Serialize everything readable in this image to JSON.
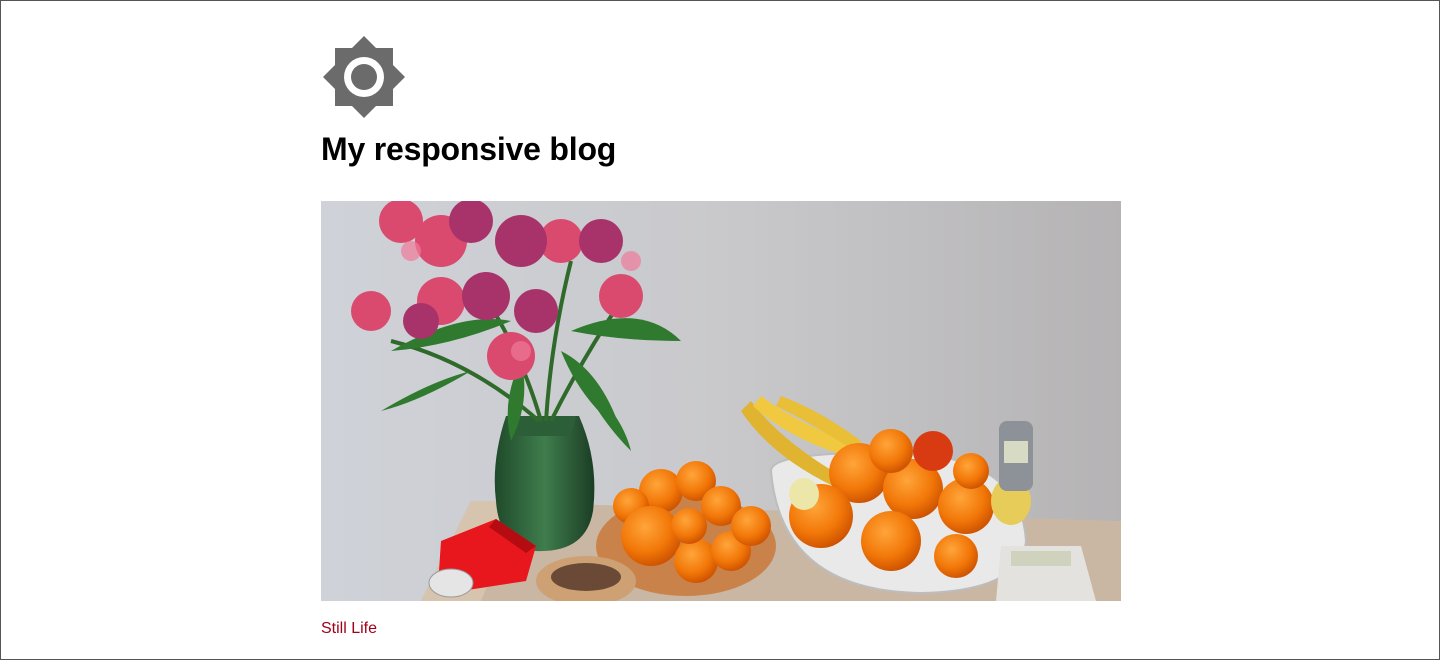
{
  "site": {
    "logo_icon": "sun-brightness-icon",
    "title": "My responsive blog"
  },
  "post": {
    "image_subject": "still-life-photo",
    "caption_link": "Still Life"
  },
  "colors": {
    "logo": "#6b6b6b",
    "link": "#a00018",
    "title": "#000000"
  }
}
